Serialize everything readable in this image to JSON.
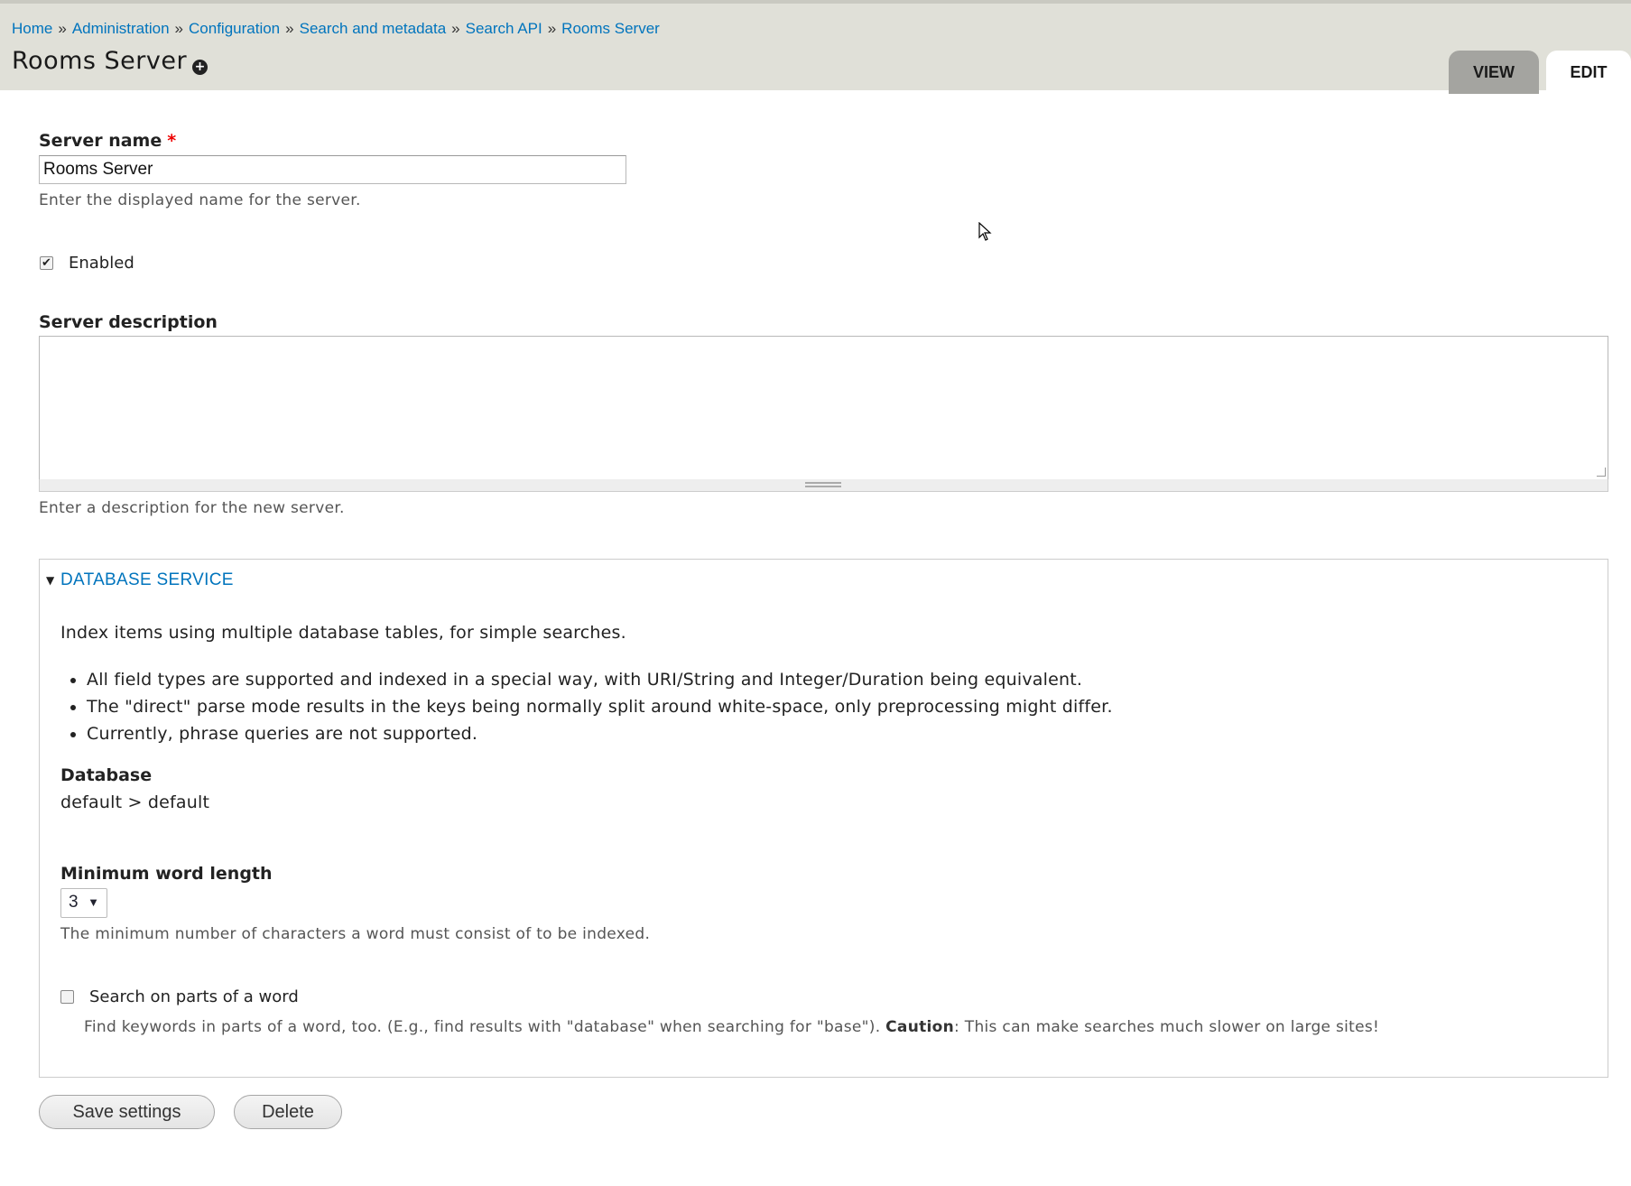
{
  "breadcrumb": [
    "Home",
    "Administration",
    "Configuration",
    "Search and metadata",
    "Search API",
    "Rooms Server"
  ],
  "page_title": "Rooms Server",
  "tabs": {
    "view": "VIEW",
    "edit": "EDIT"
  },
  "server_name": {
    "label": "Server name",
    "required_mark": "*",
    "value": "Rooms Server",
    "description": "Enter the displayed name for the server."
  },
  "enabled": {
    "label": "Enabled",
    "checked": true,
    "check_glyph": "✔"
  },
  "server_description": {
    "label": "Server description",
    "value": "",
    "description": "Enter a description for the new server."
  },
  "database_service": {
    "legend": "DATABASE SERVICE",
    "intro": "Index items using multiple database tables, for simple searches.",
    "bullets": [
      "All field types are supported and indexed in a special way, with URI/String and Integer/Duration being equivalent.",
      "The \"direct\" parse mode results in the keys being normally split around white-space, only preprocessing might differ.",
      "Currently, phrase queries are not supported."
    ],
    "database_label": "Database",
    "database_value": "default > default",
    "min_word_length": {
      "label": "Minimum word length",
      "value": "3",
      "description": "The minimum number of characters a word must consist of to be indexed."
    },
    "partial_search": {
      "label": "Search on parts of a word",
      "checked": false,
      "description_pre": "Find keywords in parts of a word, too. (E.g., find results with \"database\" when searching for \"base\"). ",
      "description_bold": "Caution",
      "description_post": ": This can make searches much slower on large sites!"
    }
  },
  "buttons": {
    "save": "Save settings",
    "delete": "Delete"
  },
  "colors": {
    "link": "#0074bd",
    "header_bg": "#e0e0d8",
    "required": "#e00000"
  }
}
